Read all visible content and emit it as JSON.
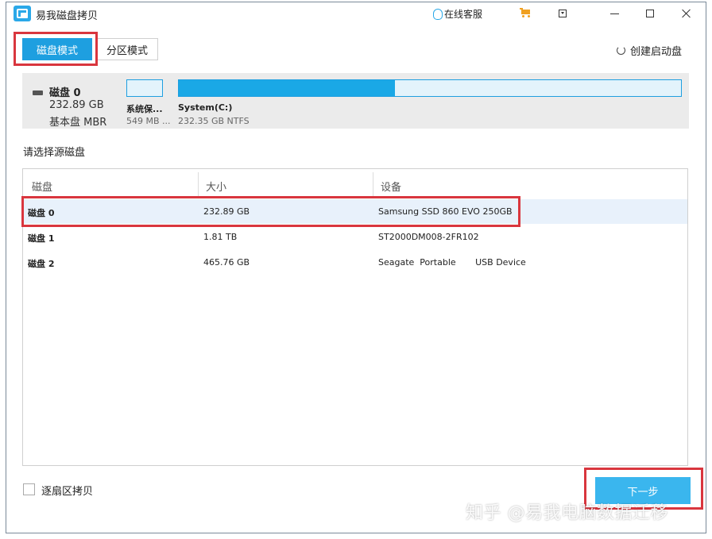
{
  "app": {
    "title": "易我磁盘拷贝"
  },
  "titlebar": {
    "online_service": "在线客服"
  },
  "tabs": {
    "disk_mode": "磁盘模式",
    "partition_mode": "分区模式"
  },
  "toolbar": {
    "create_boot": "创建启动盘"
  },
  "disk_summary": {
    "name": "磁盘 0",
    "size": "232.89 GB",
    "type": "基本盘 MBR",
    "partitions": [
      {
        "name": "系统保...",
        "info": "549 MB ..."
      },
      {
        "name": "System(C:)",
        "info": "232.35 GB NTFS",
        "used_fraction": 0.43
      }
    ]
  },
  "select_label": "请选择源磁盘",
  "table": {
    "headers": [
      "磁盘",
      "大小",
      "设备"
    ],
    "rows": [
      {
        "name": "磁盘 0",
        "size": "232.89 GB",
        "device": "Samsung SSD 860 EVO 250GB",
        "selected": true
      },
      {
        "name": "磁盘 1",
        "size": "1.81 TB",
        "device": "ST2000DM008-2FR102",
        "selected": false
      },
      {
        "name": "磁盘 2",
        "size": "465.76 GB",
        "device": "Seagate  Portable       USB Device",
        "selected": false
      }
    ]
  },
  "footer": {
    "sector_copy": "逐扇区拷贝",
    "next": "下一步"
  },
  "watermark": "知乎 @易我电脑数据迁移",
  "colors": {
    "accent": "#1e9fe0",
    "highlight": "#d9363e",
    "selected_row": "#e8f1fb"
  }
}
